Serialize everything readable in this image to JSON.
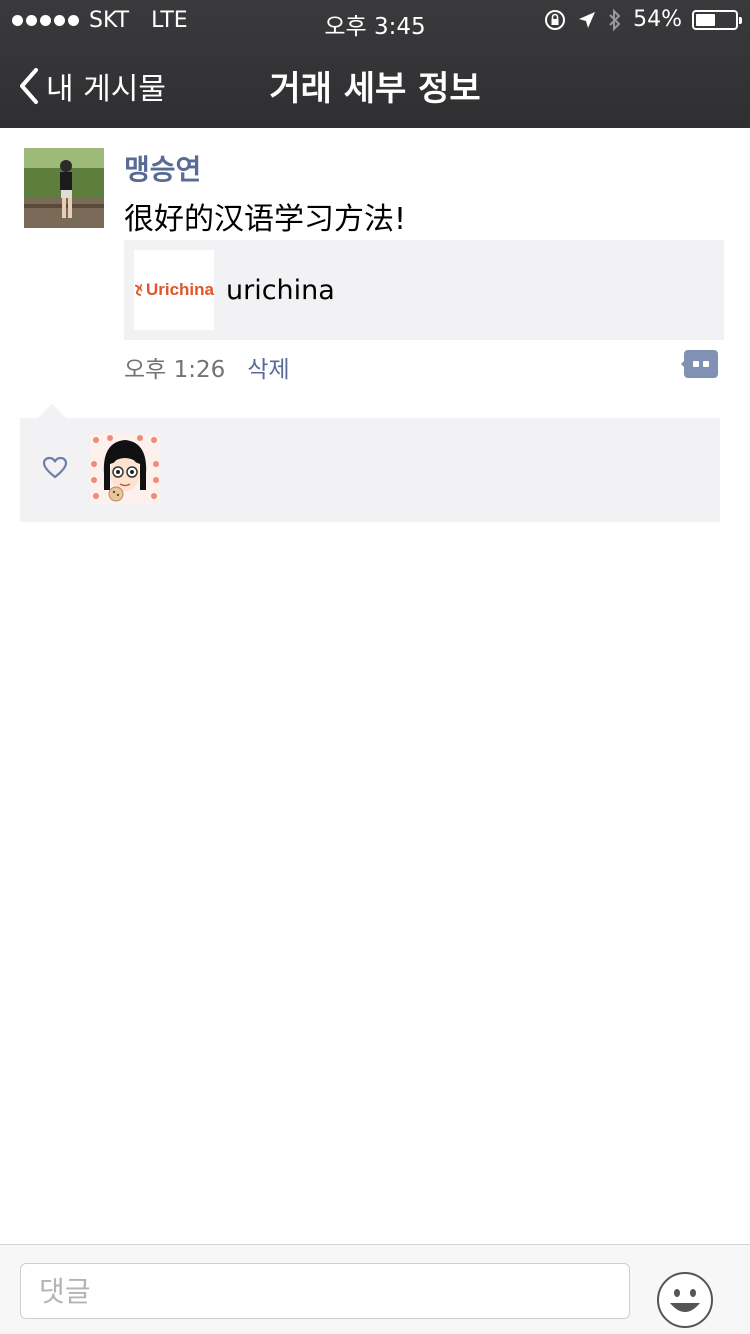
{
  "status_bar": {
    "carrier": "SKT",
    "network": "LTE",
    "time": "오후 3:45",
    "battery": "54%",
    "battery_level": 0.54
  },
  "nav": {
    "back_label": "내 게시물",
    "title": "거래 세부 정보"
  },
  "post": {
    "username": "맹승연",
    "text": "很好的汉语学习方法!",
    "link": {
      "logo_text": "Urichina",
      "title": "urichina"
    },
    "time": "오후 1:26",
    "delete_label": "삭제"
  },
  "input": {
    "placeholder": "댓글",
    "value": ""
  },
  "colors": {
    "link_blue": "#576b95",
    "bar_dark": "#333335",
    "panel_gray": "#f2f2f4"
  }
}
